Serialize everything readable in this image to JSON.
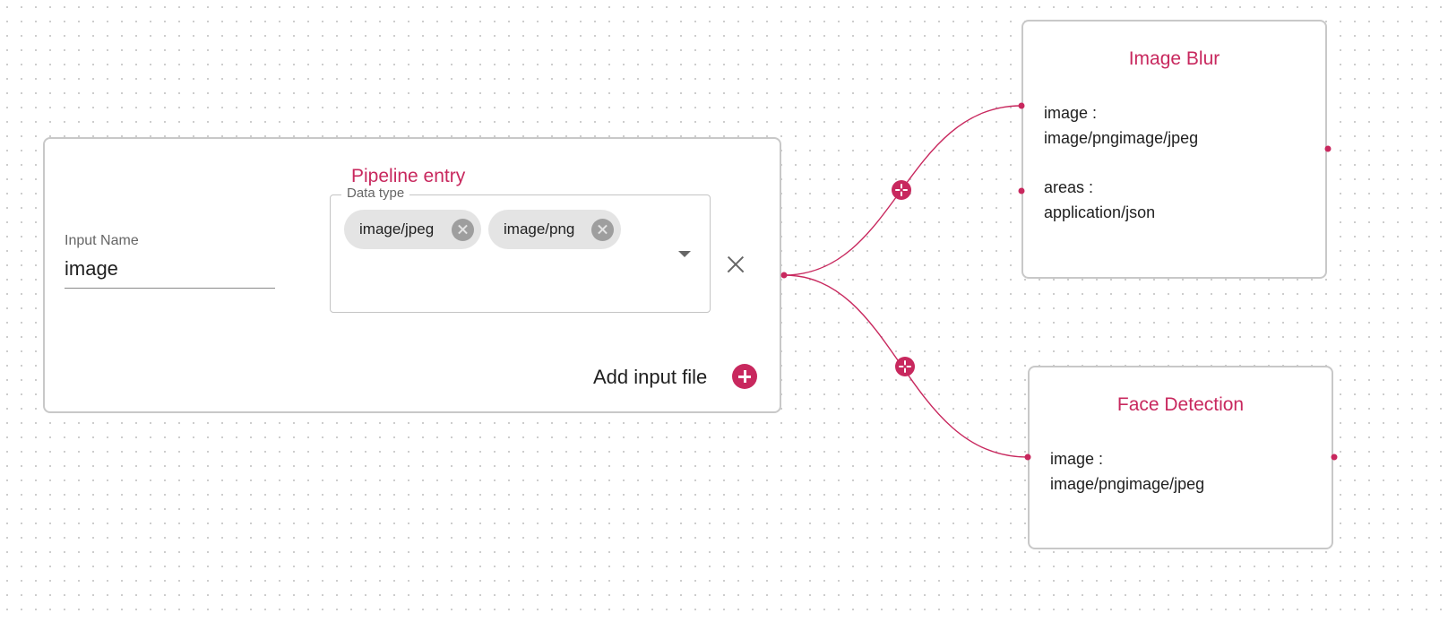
{
  "pipeline_entry": {
    "title": "Pipeline entry",
    "input_name": {
      "label": "Input Name",
      "value": "image"
    },
    "data_type": {
      "label": "Data type",
      "chips": [
        "image/jpeg",
        "image/png"
      ]
    },
    "add_input_label": "Add input file"
  },
  "nodes": [
    {
      "title": "Image Blur",
      "params": [
        {
          "name": "image :",
          "types": "image/pngimage/jpeg"
        },
        {
          "name": "areas :",
          "types": "application/json"
        }
      ]
    },
    {
      "title": "Face Detection",
      "params": [
        {
          "name": "image :",
          "types": "image/pngimage/jpeg"
        }
      ]
    }
  ],
  "colors": {
    "accent": "#c8285e",
    "node_border": "#c8c8c8",
    "chip_background": "#e4e4e4"
  }
}
